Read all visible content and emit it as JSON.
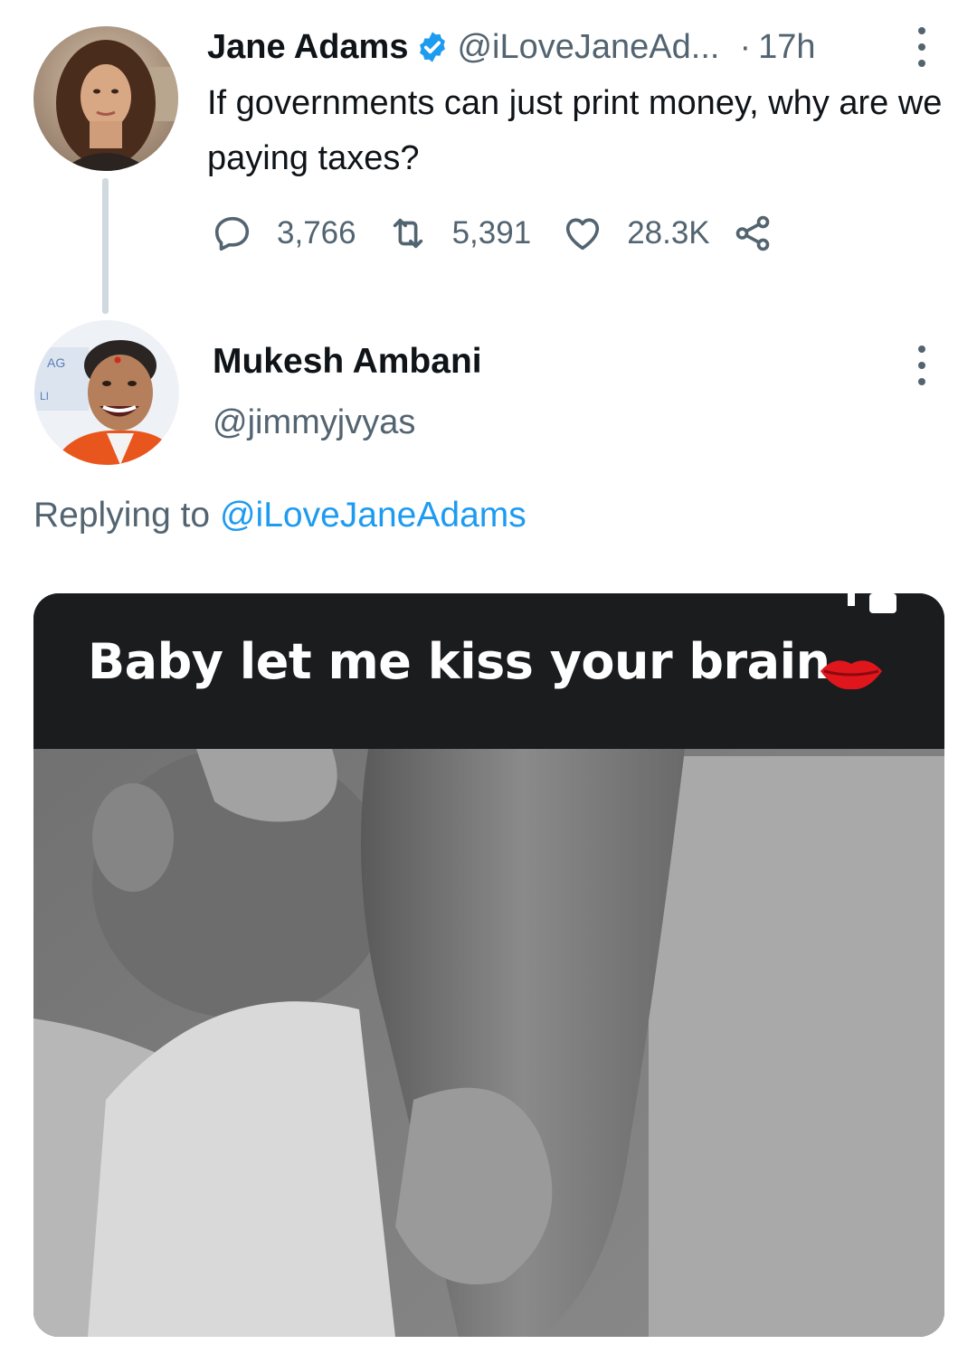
{
  "tweet": {
    "author": {
      "name": "Jane Adams",
      "handle": "@iLoveJaneAd...",
      "verified": true
    },
    "dot": "·",
    "time": "17h",
    "text": "If governments can just print money, why are we paying taxes?",
    "actions": {
      "replies": "3,766",
      "retweets": "5,391",
      "likes": "28.3K"
    }
  },
  "reply": {
    "author": {
      "name": "Mukesh Ambani",
      "handle": "@jimmyjvyas"
    },
    "replying_prefix": "Replying to",
    "replying_to": "@iLoveJaneAdams",
    "media_caption": "Baby let me kiss your brain"
  },
  "colors": {
    "text_primary": "#0f1419",
    "text_secondary": "#536471",
    "accent": "#1d9bf0",
    "thread_line": "#cfd9de"
  },
  "icons": {
    "verified": "verified-badge-icon",
    "more": "more-vertical-icon",
    "reply": "reply-icon",
    "retweet": "retweet-icon",
    "like": "heart-icon",
    "share": "share-icon",
    "lips": "lips-icon"
  }
}
